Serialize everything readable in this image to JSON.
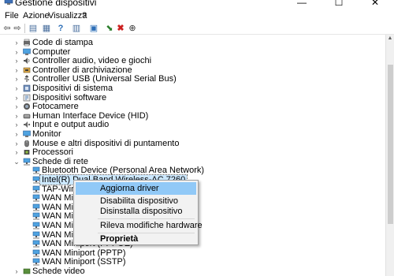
{
  "window": {
    "title": "Gestione dispositivi",
    "icon": "device-manager-icon",
    "minimize": "—",
    "maximize": "☐",
    "close": "✕"
  },
  "menu": [
    "File",
    "Azione",
    "Visualizza",
    "?"
  ],
  "toolbar": {
    "buttons": [
      {
        "name": "back-icon",
        "glyph": "⇦"
      },
      {
        "name": "forward-icon",
        "glyph": "⇨"
      },
      {
        "name": "properties-icon",
        "glyph": "▤"
      },
      {
        "name": "view-icon",
        "glyph": "▦"
      },
      {
        "name": "help-icon",
        "glyph": "?"
      },
      {
        "name": "update-driver-icon",
        "glyph": "▥"
      },
      {
        "name": "scan-hardware-icon",
        "glyph": "▣"
      },
      {
        "name": "add-driver-icon",
        "glyph": "⬊"
      },
      {
        "name": "uninstall-icon",
        "glyph": "✖"
      },
      {
        "name": "download-icon",
        "glyph": "⊕"
      }
    ],
    "accent_delete": "#cc1f1f",
    "accent_driver": "#2a7d2a"
  },
  "tree": [
    {
      "level": 1,
      "expander": "›",
      "icon": "printer-queue-icon",
      "label": "Code di stampa"
    },
    {
      "level": 1,
      "expander": "›",
      "icon": "computer-icon",
      "label": "Computer"
    },
    {
      "level": 1,
      "expander": "›",
      "icon": "speaker-icon",
      "label": "Controller audio, video e giochi"
    },
    {
      "level": 1,
      "expander": "›",
      "icon": "storage-controller-icon",
      "label": "Controller di archiviazione"
    },
    {
      "level": 1,
      "expander": "›",
      "icon": "usb-icon",
      "label": "Controller USB (Universal Serial Bus)"
    },
    {
      "level": 1,
      "expander": "›",
      "icon": "system-device-icon",
      "label": "Dispositivi di sistema"
    },
    {
      "level": 1,
      "expander": "›",
      "icon": "software-device-icon",
      "label": "Dispositivi software"
    },
    {
      "level": 1,
      "expander": "›",
      "icon": "camera-icon",
      "label": "Fotocamere"
    },
    {
      "level": 1,
      "expander": "›",
      "icon": "hid-icon",
      "label": "Human Interface Device (HID)"
    },
    {
      "level": 1,
      "expander": "›",
      "icon": "audio-io-icon",
      "label": "Input e output audio"
    },
    {
      "level": 1,
      "expander": "›",
      "icon": "monitor-icon",
      "label": "Monitor"
    },
    {
      "level": 1,
      "expander": "›",
      "icon": "mouse-icon",
      "label": "Mouse e altri dispositivi di puntamento"
    },
    {
      "level": 1,
      "expander": "›",
      "icon": "processor-icon",
      "label": "Processori"
    },
    {
      "level": 1,
      "expander": "⌄",
      "icon": "network-adapter-icon",
      "label": "Schede di rete"
    },
    {
      "level": 2,
      "expander": "",
      "icon": "network-adapter-icon",
      "label": "Bluetooth Device (Personal Area Network)"
    },
    {
      "level": 2,
      "expander": "",
      "icon": "network-adapter-icon",
      "label": "Intel(R) Dual Band Wireless-AC 7260",
      "selected": true
    },
    {
      "level": 2,
      "expander": "",
      "icon": "network-adapter-icon",
      "label": "TAP-Windows Adapter V9"
    },
    {
      "level": 2,
      "expander": "",
      "icon": "network-adapter-icon",
      "label": "WAN Miniport (IKEv2)"
    },
    {
      "level": 2,
      "expander": "",
      "icon": "network-adapter-icon",
      "label": "WAN Miniport (IP)"
    },
    {
      "level": 2,
      "expander": "",
      "icon": "network-adapter-icon",
      "label": "WAN Miniport (IPv6)"
    },
    {
      "level": 2,
      "expander": "",
      "icon": "network-adapter-icon",
      "label": "WAN Miniport (L2TP)"
    },
    {
      "level": 2,
      "expander": "",
      "icon": "network-adapter-icon",
      "label": "WAN Miniport (Network Monitor)"
    },
    {
      "level": 2,
      "expander": "",
      "icon": "network-adapter-icon",
      "label": "WAN Miniport (PPPOE)"
    },
    {
      "level": 2,
      "expander": "",
      "icon": "network-adapter-icon",
      "label": "WAN Miniport (PPTP)"
    },
    {
      "level": 2,
      "expander": "",
      "icon": "network-adapter-icon",
      "label": "WAN Miniport (SSTP)"
    },
    {
      "level": 1,
      "expander": "›",
      "icon": "display-adapter-icon",
      "label": "Schede video"
    }
  ],
  "context_menu": {
    "items": [
      {
        "label": "Aggiorna driver",
        "highlighted": true
      },
      {
        "label": "Disabilita dispositivo"
      },
      {
        "label": "Disinstalla dispositivo"
      },
      {
        "label": "Rileva modifiche hardware"
      },
      {
        "label": "Proprietà",
        "bold": true
      }
    ]
  },
  "colors": {
    "selection": "#cce8ff",
    "menu_highlight": "#91c9f7",
    "folder": "#2e6fb7"
  }
}
